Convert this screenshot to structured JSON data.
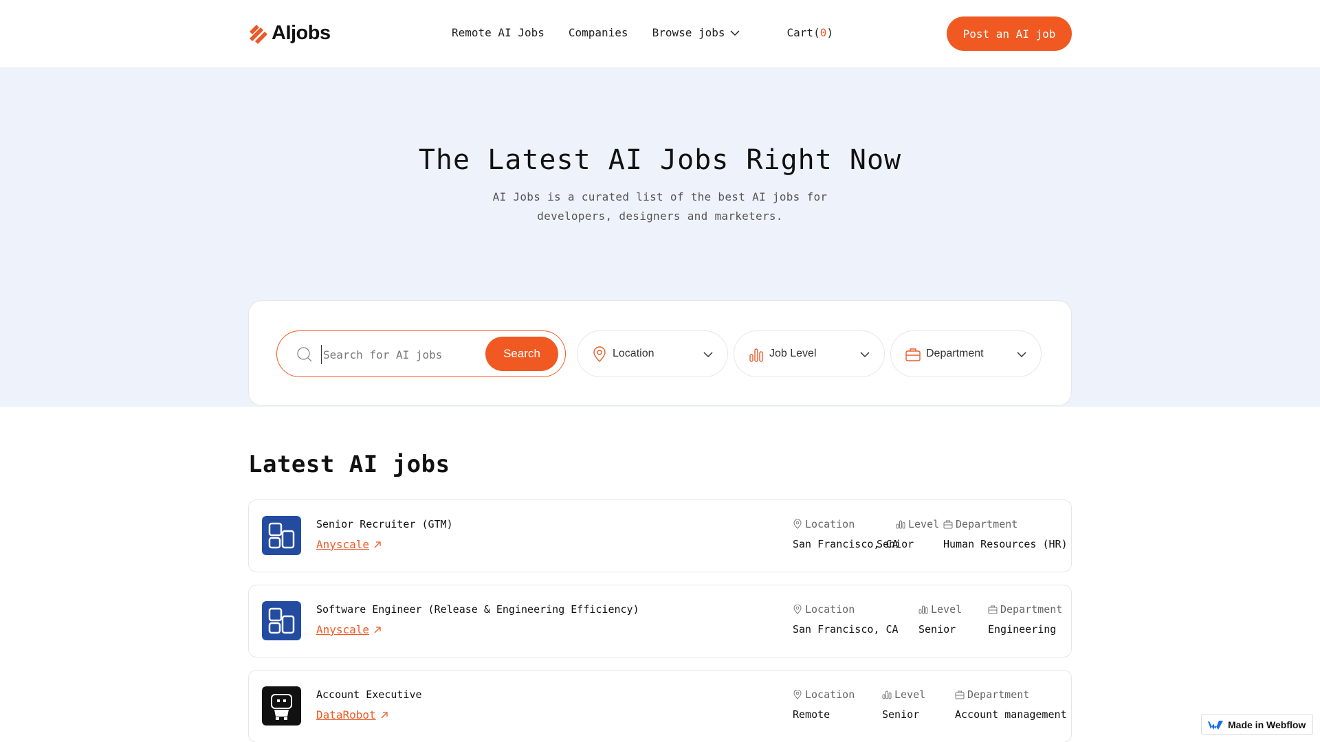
{
  "nav": {
    "logo_text": "AIjobs",
    "links": [
      "Remote AI Jobs",
      "Companies"
    ],
    "browse_label": "Browse jobs",
    "cart_label": "Cart(",
    "cart_count": "0",
    "cart_close": ")",
    "post_button": "Post an AI job"
  },
  "hero": {
    "title": "The Latest AI Jobs Right Now",
    "subtitle": "AI Jobs is a curated list of the best AI jobs for developers, designers and marketers."
  },
  "search": {
    "placeholder": "Search for AI jobs",
    "button": "Search",
    "filters": [
      "Location",
      "Job Level",
      "Department"
    ]
  },
  "list": {
    "title": "Latest AI jobs",
    "meta_headers": {
      "location": "Location",
      "level": "Level",
      "department": "Department"
    },
    "jobs": [
      {
        "title": "Senior Recruiter (GTM)",
        "company": "Anyscale",
        "location": "San Francisco, CA",
        "level": "Senior",
        "department": "Human Resources (HR)",
        "logo": "anyscale-logo"
      },
      {
        "title": "Software Engineer (Release & Engineering Efficiency)",
        "company": "Anyscale",
        "location": "San Francisco, CA",
        "level": "Senior",
        "department": "Engineering",
        "logo": "anyscale-logo"
      },
      {
        "title": "Account Executive",
        "company": "DataRobot",
        "location": "Remote",
        "level": "Senior",
        "department": "Account management",
        "logo": "datarobot-logo"
      }
    ]
  },
  "badge": {
    "label": "Made in Webflow"
  },
  "colors": {
    "accent": "#f05a22",
    "hero_bg": "#eef2fb",
    "anyscale": "#234ba0",
    "datarobot": "#111111"
  }
}
